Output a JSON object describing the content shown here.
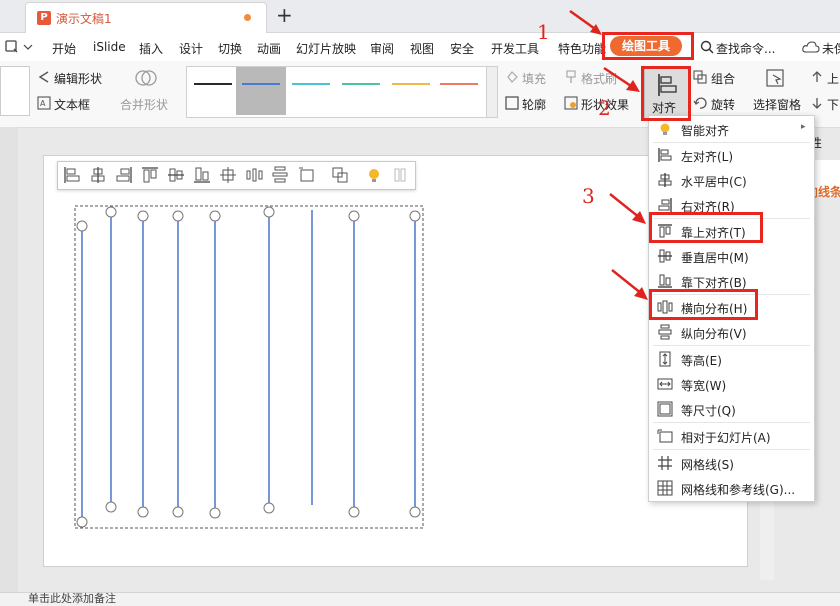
{
  "window": {
    "doc_tab_title": "演示文稿1",
    "doc_icon_letter": "P",
    "new_tab": "+"
  },
  "menubar": {
    "items": [
      "开始",
      "iSlide",
      "插入",
      "设计",
      "切换",
      "动画",
      "幻灯片放映",
      "审阅",
      "视图",
      "安全",
      "开发工具",
      "特色功能"
    ],
    "active_tab": "绘图工具",
    "search": "查找命令...",
    "cloud": "未保"
  },
  "ribbon": {
    "edit_shape": "编辑形状",
    "text_box": "文本框",
    "merge_shape": "合并形状",
    "fill": "填充",
    "format_brush": "格式刷",
    "outline": "轮廓",
    "shape_effect": "形状效果",
    "align": "对齐",
    "group": "组合",
    "rotate": "旋转",
    "selection_pane": "选择窗格",
    "move_up": "上",
    "move_down": "下",
    "style_colors": [
      "#2a2a2a",
      "#4a7bd0",
      "#4bc3d6",
      "#4fc69a",
      "#f4b84a",
      "#ee7a6a"
    ]
  },
  "side_panel": {
    "attr": "属性",
    "line": "向线条"
  },
  "dropdown": {
    "smart_align": "智能对齐",
    "left": "左对齐(L)",
    "center_h": "水平居中(C)",
    "right": "右对齐(R)",
    "top": "靠上对齐(T)",
    "middle_v": "垂直居中(M)",
    "bottom": "靠下对齐(B)",
    "dist_h": "横向分布(H)",
    "dist_v": "纵向分布(V)",
    "same_height": "等高(E)",
    "same_width": "等宽(W)",
    "same_size": "等尺寸(Q)",
    "rel_slide": "相对于幻灯片(A)",
    "grid": "网格线(S)",
    "grid_guides": "网格线和参考线(G)..."
  },
  "annotations": {
    "step1": "1",
    "step2": "2",
    "step3": "3",
    "highlight_color": "#e8251f"
  },
  "status": {
    "notes": "单击此处添加备注"
  }
}
